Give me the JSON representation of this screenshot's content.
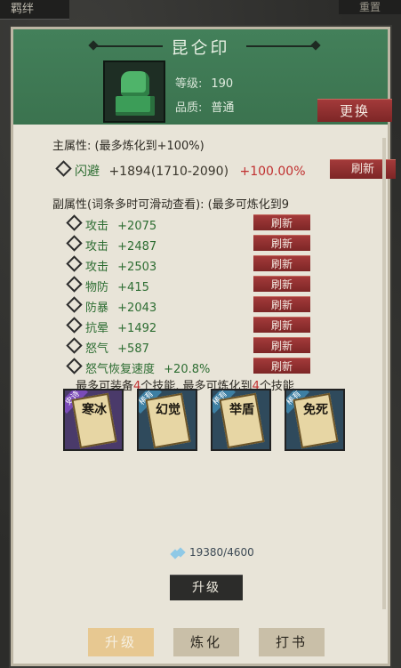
{
  "top_left_tab": "羁绊",
  "top_right_tab": "重置",
  "item": {
    "title": "昆仑印",
    "icon": "jade-seal-icon",
    "level_label": "等级:",
    "level_value": "190",
    "quality_label": "品质:",
    "quality_value": "普通",
    "change_button": "更换"
  },
  "main_attr": {
    "header": "主属性: (最多炼化到+100%)",
    "name": "闪避",
    "value": "+1894(1710-2090)",
    "percent": "+100.00%",
    "refresh": "刷新"
  },
  "sub_attr_header": "副属性(词条多时可滑动查看): (最多可炼化到9",
  "sub_attrs": [
    {
      "name": "攻击",
      "value": "+2075",
      "refresh": "刷新"
    },
    {
      "name": "攻击",
      "value": "+2487",
      "refresh": "刷新"
    },
    {
      "name": "攻击",
      "value": "+2503",
      "refresh": "刷新"
    },
    {
      "name": "物防",
      "value": "+415",
      "refresh": "刷新"
    },
    {
      "name": "防暴",
      "value": "+2043",
      "refresh": "刷新"
    },
    {
      "name": "抗晕",
      "value": "+1492",
      "refresh": "刷新"
    },
    {
      "name": "怒气",
      "value": "+587",
      "refresh": "刷新"
    },
    {
      "name": "怒气恢复速度",
      "value": "+20.8%",
      "refresh": "刷新"
    }
  ],
  "skills_note": {
    "prefix": "最多可装备",
    "equip_count": "4",
    "middle": "个技能, 最多可炼化到",
    "refine_count": "4",
    "suffix": "个技能"
  },
  "skills": [
    {
      "name": "寒冰",
      "tag": "史诗",
      "rarity_color": "#7a4bb8"
    },
    {
      "name": "幻觉",
      "tag": "稀有",
      "rarity_color": "#3d7fa3"
    },
    {
      "name": "举盾",
      "tag": "稀有",
      "rarity_color": "#3d7fa3"
    },
    {
      "name": "免死",
      "tag": "稀有",
      "rarity_color": "#3d7fa3"
    }
  ],
  "cost": {
    "icon": "crystal-gem-icon",
    "text": "19380/4600"
  },
  "upgrade_button": "升级",
  "bottom_tabs": [
    {
      "label": "升级",
      "active": true
    },
    {
      "label": "炼化",
      "active": false
    },
    {
      "label": "打书",
      "active": false
    }
  ]
}
